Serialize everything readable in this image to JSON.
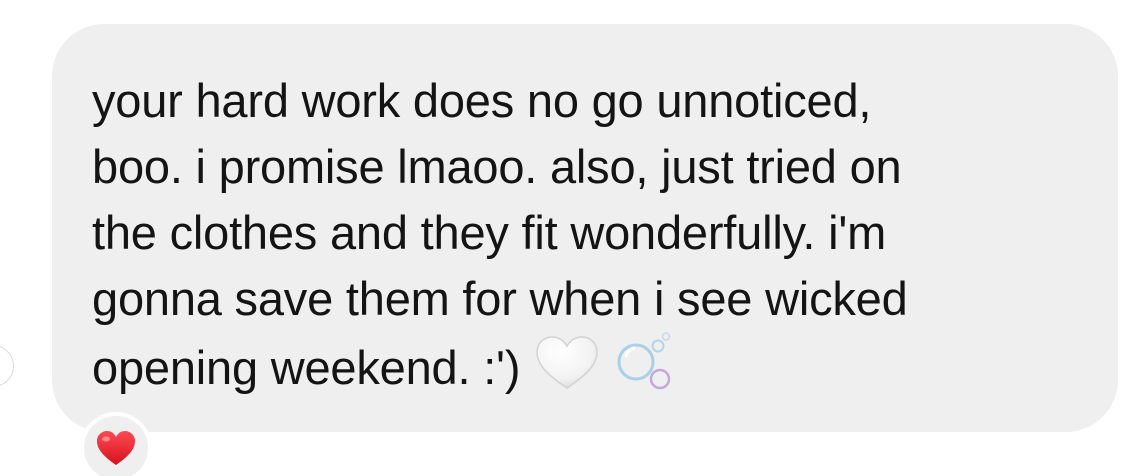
{
  "message": {
    "lines": [
      "your hard work does no go unnoticed,",
      "boo. i promise lmaoo. also, just tried on",
      "the clothes and they fit wonderfully. i'm",
      "gonna save them for when i see wicked",
      "opening weekend. :')"
    ],
    "trailing_emojis": [
      "white-heart-icon",
      "bubbles-icon"
    ]
  },
  "reaction": {
    "emoji": "red-heart-icon"
  },
  "colors": {
    "bubble": "#efefef",
    "text": "#141414",
    "reaction_heart": "#e8232e",
    "white_heart": "#f4f4f4",
    "bubbles": "#b8d8ee"
  }
}
